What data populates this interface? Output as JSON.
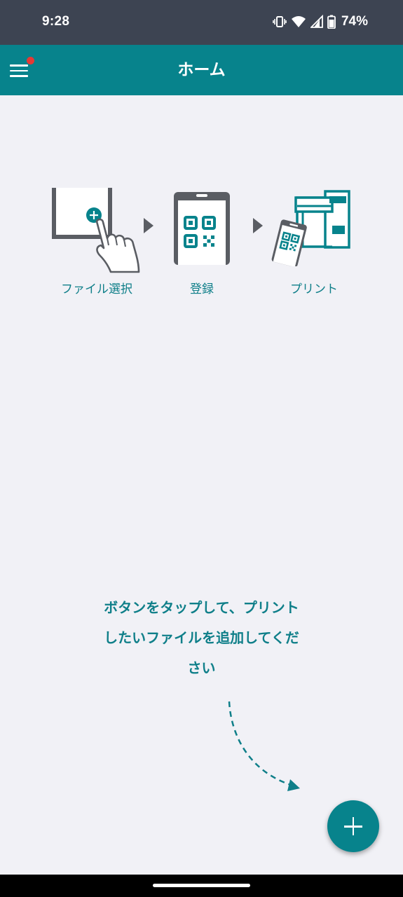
{
  "status_bar": {
    "time": "9:28",
    "battery_percent": "74%",
    "icons": [
      "vibrate-icon",
      "wifi-icon",
      "cell-signal-icon",
      "battery-icon"
    ]
  },
  "app_bar": {
    "title": "ホーム",
    "menu_icon": "hamburger-menu-icon",
    "has_notification_dot": true
  },
  "steps": [
    {
      "label": "ファイル選択",
      "icon": "file-select-illustration"
    },
    {
      "label": "登録",
      "icon": "phone-qr-illustration"
    },
    {
      "label": "プリント",
      "icon": "printer-illustration"
    }
  ],
  "instruction": {
    "line1": "ボタンをタップして、プリント",
    "line2": "したいファイルを追加してくだ",
    "line3": "さい"
  },
  "fab": {
    "icon": "plus-icon"
  },
  "colors": {
    "primary": "#07838c",
    "text_accent": "#0f7f89",
    "status_bar": "#3d4452",
    "background": "#f1f1f6",
    "notification_dot": "#e53935"
  }
}
